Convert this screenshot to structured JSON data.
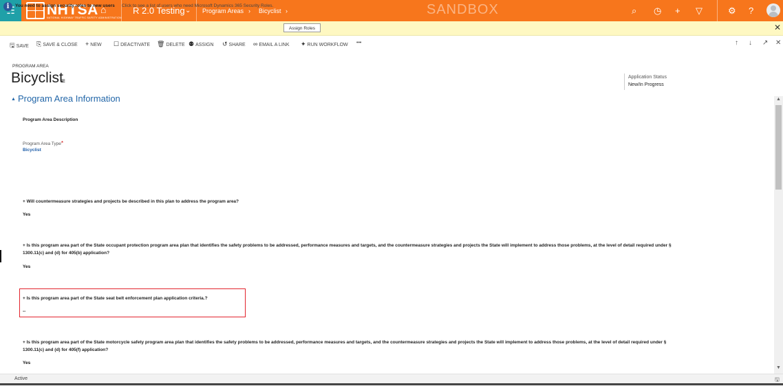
{
  "topbar": {
    "logo_text": "NHTSA",
    "logo_subtitle": "NATIONAL HIGHWAY TRAFFIC SAFETY ADMINISTRATION",
    "app_name": "R 2.0 Testing",
    "breadcrumb": [
      "Program Areas",
      "Bicyclist"
    ],
    "environment_label": "SANDBOX",
    "icons": [
      "app-launcher-icon",
      "home-icon",
      "search-icon",
      "recent-icon",
      "new-icon",
      "filter-icon",
      "settings-icon",
      "help-icon",
      "user-avatar-icon"
    ],
    "brand_color": "#f7761c",
    "waffle_color": "#1fa0a8"
  },
  "notification": {
    "message": "You need to assign security roles to new users",
    "detail": "Click to see a list of users who need Microsoft Dynamics 365 Security Roles.",
    "button_label": "Assign Roles"
  },
  "commands": [
    {
      "label": "SAVE",
      "icon": "save-icon"
    },
    {
      "label": "SAVE & CLOSE",
      "icon": "save-close-icon"
    },
    {
      "label": "NEW",
      "icon": "plus-icon"
    },
    {
      "label": "DEACTIVATE",
      "icon": "deactivate-icon"
    },
    {
      "label": "DELETE",
      "icon": "trash-icon"
    },
    {
      "label": "ASSIGN",
      "icon": "assign-icon"
    },
    {
      "label": "SHARE",
      "icon": "share-icon"
    },
    {
      "label": "EMAIL A LINK",
      "icon": "link-icon"
    },
    {
      "label": "RUN WORKFLOW",
      "icon": "workflow-icon"
    },
    {
      "label": "•••",
      "icon": "more-icon"
    }
  ],
  "record": {
    "entity_type": "PROGRAM AREA",
    "title": "Bicyclist",
    "header_field_label": "Application Status",
    "header_field_value": "New/In Progress"
  },
  "section": {
    "title": "Program Area Information"
  },
  "fields": {
    "description_label": "Program Area Description",
    "type_label": "Program Area Type",
    "type_required_marker": "*",
    "type_value": "Bicyclist",
    "q1_label": "+ Will countermeasure strategies and projects be described in this plan to address the program area?",
    "q1_value": "Yes",
    "q2_label": "+ Is this program area part of the State occupant protection program area plan that identifies the safety problems to be addressed, performance measures and targets, and the countermeasure strategies and projects the State will implement to address those problems, at the level of detail required under §",
    "q2_label_cont": "1300.11(c) and (d) for 405(b) application?",
    "q2_value": "Yes",
    "q3_label": "+ Is this program area part of the State seat belt enforcement plan application criteria.?",
    "q3_value": "--",
    "q4_label": "+ Is this program area part of the State motorcycle safety program area plan that identifies the safety problems to be addressed, performance measures and targets, and the countermeasure strategies and projects the State will implement to address those problems, at the level of detail required under §",
    "q4_label_cont": "1300.11(c) and (d) for 405(f) application?",
    "q4_value": "Yes"
  },
  "footer": {
    "status": "Active"
  }
}
